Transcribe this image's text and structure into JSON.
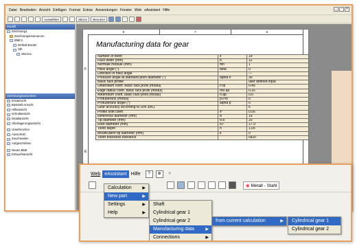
{
  "back": {
    "menu": [
      "Datei",
      "Bearbeiten",
      "Ansicht",
      "Einfügen",
      "Format",
      "Extras",
      "Anwendungen",
      "Fenster",
      "Web",
      "eAssistant",
      "Hilfe"
    ],
    "toolbar2": {
      "combo1": "Auswählen",
      "combo2": "Skizze",
      "combo3": "Benutzer"
    },
    "panel1": {
      "title": "Modell",
      "items": [
        "Zeichnung1",
        "Zeichnungsressourcen",
        "Blatt:1",
        "Default Border",
        "Sth",
        "Skizze1"
      ]
    },
    "panel2": {
      "title": "Zeichnungsansichten",
      "items": [
        "Erstansicht",
        "Basisteil-Ansicht",
        "Hilfsansicht",
        "Schnittansicht",
        "Detailansicht",
        "Überlagerungsansicht",
        "Unterbrochen",
        "Ausschnitt",
        "Zuschneiden",
        "Aufgeschnitten",
        "Neues Blatt",
        "Entwurfsansicht"
      ]
    },
    "sheet": {
      "title": "Manufacturing data for gear",
      "cols": [
        "8",
        "7",
        "6"
      ],
      "rows": [
        "F",
        "E"
      ],
      "table": [
        [
          "Number of teeth",
          "z",
          "19"
        ],
        [
          "Face width (mm)",
          "b",
          "12"
        ],
        [
          "Normale module (mm)",
          "mn",
          "1"
        ],
        [
          "Helix angle (°)",
          "beta",
          "0"
        ],
        [
          "Direction of helix angle",
          "",
          "---"
        ],
        [
          "Pressure angle at standard pitch diameter (°)",
          "alpha n",
          "30"
        ],
        [
          "Basic rack profile",
          "",
          "user defined input"
        ],
        [
          "Dedendum coeff. basic rack profil (modul)",
          "h fp",
          "0.45"
        ],
        [
          "Edge radius coeff. basic rack profil (modul)",
          "rho aa",
          "0.16"
        ],
        [
          "Addendum coeff. basic rack profil (modul)",
          "h ap",
          "0.6"
        ],
        [
          "Protuberanz (modul)",
          "p.Pro",
          "0"
        ],
        [
          "Protuberanz angle (°)",
          "alpha p",
          "0"
        ],
        [
          "Gear accuracy according to DIN 3961",
          "",
          "6"
        ],
        [
          "Profile shift coeff.",
          "x*",
          "0.05"
        ],
        [
          "Reference diameter (mm)",
          "d",
          "19"
        ],
        [
          "Tip diameter (mm)",
          "d a",
          "20"
        ],
        [
          "Root diameter (mm)",
          "d f",
          "17.9"
        ],
        [
          "Tooth depth",
          "h",
          "1.05"
        ],
        [
          "Modification tip diameter (mm)",
          "k",
          "0"
        ],
        [
          "Tooth thickness tolerance",
          "",
          "cd25"
        ]
      ]
    }
  },
  "front": {
    "menu": {
      "web": "Web",
      "eassistant": "eAssistant",
      "hilfe": "Hilfe"
    },
    "material": "Metall - Stahl",
    "menu1": [
      "Calculation",
      "New part",
      "Settings",
      "Help"
    ],
    "menu2": [
      "Shaft",
      "Cylindrical gear 1",
      "Cylindrical gear 2",
      "Manufacturing data",
      "Connections"
    ],
    "menu3": [
      "from current calculation"
    ],
    "menu4": [
      "Cylindrical gear 1",
      "Cylindrical gear 2"
    ]
  }
}
